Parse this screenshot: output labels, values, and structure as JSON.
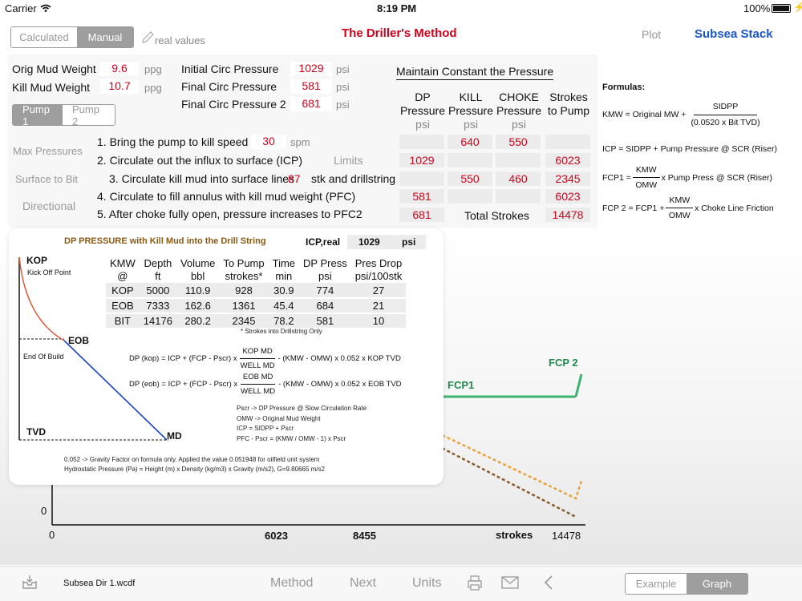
{
  "status": {
    "carrier": "Carrier",
    "time": "8:19 PM",
    "battery": "100%"
  },
  "nav": {
    "title": "The Driller's Method",
    "plot": "Plot",
    "subsea": "Subsea Stack",
    "calc": "Calculated",
    "manual": "Manual",
    "real": "real values"
  },
  "mud": {
    "orig_label": "Orig Mud Weight",
    "orig_val": "9.6",
    "kill_label": "Kill Mud Weight",
    "kill_val": "10.7",
    "unit": "ppg"
  },
  "circ": {
    "icp_label": "Initial Circ Pressure",
    "icp_val": "1029",
    "fcp_label": "Final Circ Pressure",
    "fcp_val": "581",
    "fcp2_label": "Final Circ Pressure 2",
    "fcp2_val": "681",
    "unit": "psi"
  },
  "pumps": [
    "Pump 1",
    "Pump 2"
  ],
  "sidebar": [
    "Max Pressures",
    "Surface to Bit",
    "Directional"
  ],
  "steps": {
    "s1": "1. Bring the pump to kill speed",
    "s1_val": "30",
    "s1_unit": "spm",
    "s2": "2. Circulate out the influx to surface (ICP)",
    "limits": "Limits",
    "s3a": "3. Circulate kill mud into surface lines",
    "s3_val": "87",
    "s3b": "stk and drillstring",
    "s4": "4. Circulate to fill annulus with kill mud weight (PFC)",
    "s5": "5. After choke fully open, pressure increases to PFC2"
  },
  "maintain": {
    "title": "Maintain Constant the Pressure",
    "h_dp": [
      "DP",
      "Pressure",
      "psi"
    ],
    "h_kill": [
      "KILL",
      "Pressure",
      "psi"
    ],
    "h_choke": [
      "CHOKE",
      "Pressure",
      "psi"
    ],
    "h_str": [
      "Strokes",
      "to Pump"
    ],
    "r1_kill": "640",
    "r1_choke": "550",
    "r2_dp": "1029",
    "r2_str": "6023",
    "r3_kill": "550",
    "r3_choke": "460",
    "r3_str": "2345",
    "r4_dp": "581",
    "r4_str": "6023",
    "r5_dp": "681",
    "total_label": "Total Strokes",
    "total_val": "14478"
  },
  "formulas": {
    "title": "Formulas:",
    "kmw_a": "KMW = Original MW +",
    "kmw_num": "SIDPP",
    "kmw_den": "(0.0520 x Bit TVD)",
    "icp": "ICP = SIDPP + Pump Pressure @ SCR (Riser)",
    "fcp1_a": "FCP1 =",
    "fcp1_num": "KMW",
    "fcp1_den": "OMW",
    "fcp1_b": "x Pump Press @ SCR (Riser)",
    "fcp2_a": "FCP 2 = FCP1 +",
    "fcp2_num": "KMW",
    "fcp2_den": "OMW",
    "fcp2_b": "x Choke Line Friction"
  },
  "popup": {
    "title": "DP PRESSURE with Kill Mud into the Drill String",
    "icp_label": "ICP,real",
    "icp_val": "1029",
    "icp_unit": "psi",
    "kop": "KOP",
    "kop_sub": "Kick Off Point",
    "eob": "EOB",
    "eob_sub": "End Of Build",
    "tvd": "TVD",
    "md": "MD",
    "headers": [
      [
        "KMW",
        "@"
      ],
      [
        "Depth",
        "ft"
      ],
      [
        "Volume",
        "bbl"
      ],
      [
        "To Pump",
        "strokes*"
      ],
      [
        "Time",
        "min"
      ],
      [
        "DP Press",
        "psi"
      ],
      [
        "Pres Drop",
        "psi/100stk"
      ]
    ],
    "rows": [
      [
        "KOP",
        "5000",
        "110.9",
        "928",
        "30.9",
        "774",
        "27"
      ],
      [
        "EOB",
        "7333",
        "162.6",
        "1361",
        "45.4",
        "684",
        "21"
      ],
      [
        "BIT",
        "14176",
        "280.2",
        "2345",
        "78.2",
        "581",
        "10"
      ]
    ],
    "note": "* Strokes into Drillstring Only",
    "f1_a": "DP (kop) = ICP + (FCP - Pscr) x",
    "f1_num": "KOP MD",
    "f1_den": "WELL MD",
    "f1_b": "- (KMW - OMW) x 0.052 x KOP TVD",
    "f2_a": "DP (eob) = ICP + (FCP - Pscr) x",
    "f2_num": "EOB MD",
    "f2_den": "WELL MD",
    "f2_b": "- (KMW - OMW) x 0.052 x EOB TVD",
    "leg": [
      "Pscr -> DP Pressure @ Slow Circulation Rate",
      "OMW -> Original Mud Weight",
      "ICP = SIDPP + Pscr",
      "PFC - Pscr = (KMW / OMW - 1) x Pscr"
    ],
    "foot": [
      "0.052 -> Gravity Factor on formula only. Applied the value 0.051948 for oilfield unit system",
      "Hydrostatic Pressure (Pa) = Height (m) x Density (kg/m3) x Gravity (m/s2), G=9.80665 m/s2"
    ]
  },
  "chart": {
    "fcp1": "FCP1",
    "fcp2": "FCP 2",
    "y0": "0",
    "x0": "0",
    "x1": "6023",
    "x2": "8455",
    "xlabel": "strokes",
    "x3": "14478"
  },
  "toolbar": {
    "file": "Subsea Dir 1.wcdf",
    "method": "Method",
    "next": "Next",
    "units": "Units",
    "example": "Example",
    "graph": "Graph"
  }
}
